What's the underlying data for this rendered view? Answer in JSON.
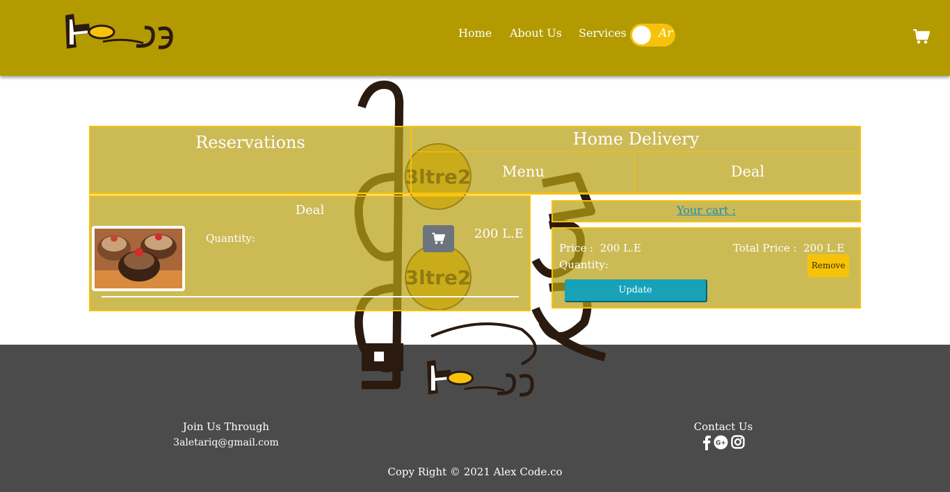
{
  "header": {
    "logo_icon": "3altre2-logo",
    "nav": {
      "home": "Home",
      "about": "About Us",
      "services": "Services"
    },
    "language_toggle": "Ar",
    "cart_icon": "shopping-cart-icon"
  },
  "tabs": {
    "reservations": "Reservations",
    "home_delivery": "Home Delivery",
    "menu": "Menu",
    "deal": "Deal"
  },
  "deal_panel": {
    "title": "Deal",
    "image": "cupcakes-photo",
    "quantity_label": "Quantity:",
    "add_to_cart_icon": "shopping-cart-icon",
    "price": "200 L.E"
  },
  "cart": {
    "title": "Your cart :",
    "item": {
      "price_label": "Price :",
      "price": "200 L.E",
      "total_label": "Total Price :",
      "total": "200 L.E",
      "quantity_label": "Quantity:",
      "remove_label": "Remove",
      "update_label": "Update"
    }
  },
  "footer": {
    "join_title": "Join Us Through",
    "email": "3aletariq@gmail.com",
    "contact_title": "Contact Us",
    "social_icons": [
      "facebook-icon",
      "google-plus-icon",
      "instagram-icon"
    ],
    "copyright": "Copy Right © 2021   Alex Code.co"
  },
  "colors": {
    "header_bg": "#b29a00",
    "accent_yellow": "#f7c20a",
    "panel_bg": "#b9a014",
    "update_button": "#17a2b8",
    "cart_button": "#6c757d",
    "footer_bg": "#4b4b4b",
    "cart_link": "#1b8ab8"
  }
}
